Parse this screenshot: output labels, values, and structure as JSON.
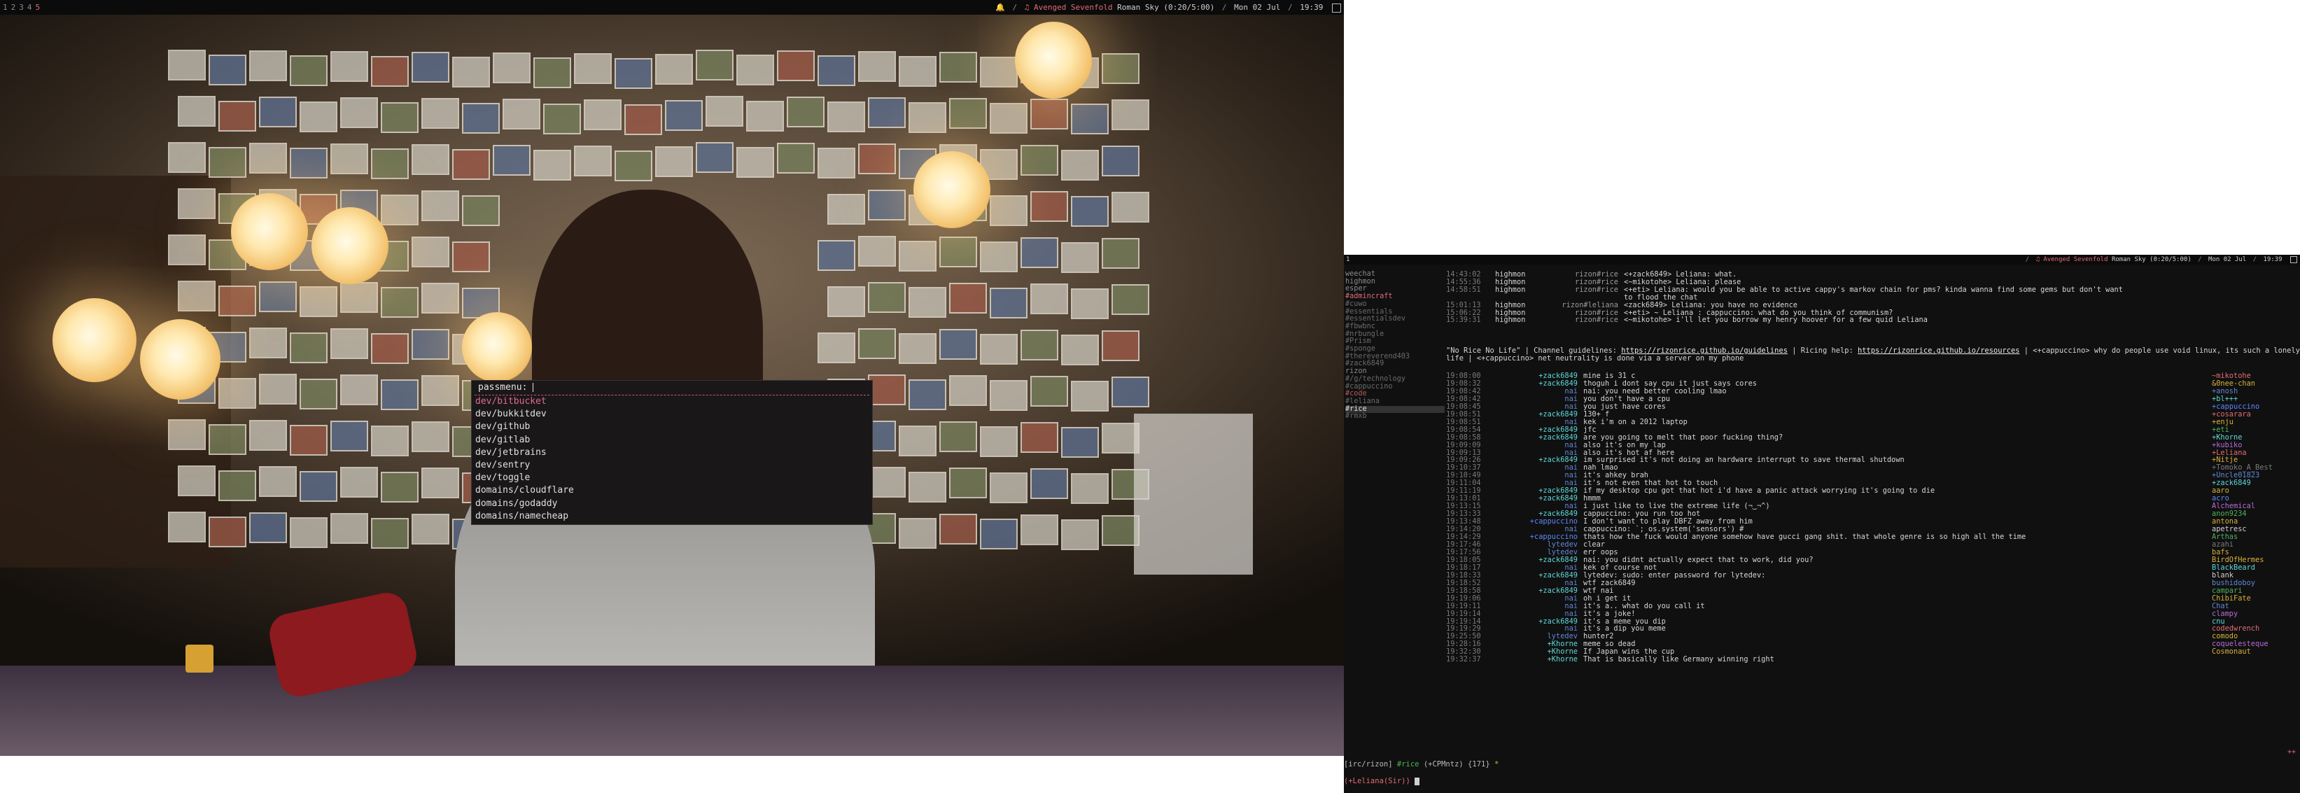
{
  "left_bar": {
    "workspaces": [
      "1",
      "2",
      "3",
      "4",
      "5"
    ],
    "active_workspace": "5",
    "bell": "🔔",
    "now_playing": "Avenged Sevenfold",
    "song": "Roman Sky",
    "track_time": "(0:20/5:00)",
    "date": "Mon 02 Jul",
    "time": "19:39"
  },
  "passmenu": {
    "prompt": "passmenu:",
    "items": [
      "dev/bitbucket",
      "dev/bukkitdev",
      "dev/github",
      "dev/gitlab",
      "dev/jetbrains",
      "dev/sentry",
      "dev/toggle",
      "domains/cloudflare",
      "domains/godaddy",
      "domains/namecheap"
    ],
    "selected_index": 0
  },
  "right_bar": {
    "workspace": "1",
    "now_playing": "Avenged Sevenfold",
    "song": "Roman Sky",
    "track_time": "(0:20/5:00)",
    "date": "Mon 02 Jul",
    "time": "19:39"
  },
  "buffers": [
    {
      "name": "weechat",
      "kind": "net"
    },
    {
      "name": "highmon",
      "kind": "net"
    },
    {
      "name": "esper",
      "kind": "net"
    },
    {
      "name": " #admincraft",
      "kind": "hot"
    },
    {
      "name": " #cuwo",
      "kind": "dim"
    },
    {
      "name": " #essentials",
      "kind": "dim"
    },
    {
      "name": " #essentialsdev",
      "kind": "dim"
    },
    {
      "name": " #fbwbnc",
      "kind": "dim"
    },
    {
      "name": " #nrbungle",
      "kind": "dim"
    },
    {
      "name": " #Prism",
      "kind": "dim"
    },
    {
      "name": " #sponge",
      "kind": "dim"
    },
    {
      "name": " #thereverend403",
      "kind": "dim"
    },
    {
      "name": " #zack6849",
      "kind": "dim"
    },
    {
      "name": "rizon",
      "kind": "net"
    },
    {
      "name": " #/g/technology",
      "kind": "dim"
    },
    {
      "name": " #cappuccino",
      "kind": "dim"
    },
    {
      "name": " #code",
      "kind": "red"
    },
    {
      "name": " #leliana",
      "kind": "dim"
    },
    {
      "name": " #rice",
      "kind": "cur"
    },
    {
      "name": " #rmxb",
      "kind": "dim"
    }
  ],
  "server_pane": [
    {
      "time": "14:43:02",
      "who": "highmon",
      "ch": "rizon#rice",
      "msg": "<+zack6849> Leliana: what."
    },
    {
      "time": "14:55:36",
      "who": "highmon",
      "ch": "rizon#rice",
      "msg": "<~mikotohe> Leliana: please"
    },
    {
      "time": "14:58:51",
      "who": "highmon",
      "ch": "rizon#rice",
      "msg": "<+eti> Leliana: would you be able to active cappy's markov chain for pms? kinda wanna find some gems but don't want"
    },
    {
      "time": "",
      "who": "",
      "ch": "",
      "msg": "to flood the chat"
    },
    {
      "time": "15:01:13",
      "who": "highmon",
      "ch": "rizon#leliana",
      "msg": "<zack6849> Leliana: you have no evidence"
    },
    {
      "time": "15:06:22",
      "who": "highmon",
      "ch": "rizon#rice",
      "msg": "<+eti> ~ Leliana : cappuccino: what do you think of communism?"
    },
    {
      "time": "15:39:31",
      "who": "highmon",
      "ch": "rizon#rice",
      "msg": "<~mikotohe> i'll let you borrow my henry hoover for a few quid Leliana"
    }
  ],
  "topic": {
    "pre": "\"No Rice No Life\" | Channel guidelines: ",
    "link1": "https://rizonrice.github.io/guidelines",
    "mid": " | Ricing help: ",
    "link2": "https://rizonrice.github.io/resources",
    "post": " | <+cappuccino> why do people use void linux, its such a lonely life | <+cappuccino> net neutrality is done via a server on my phone"
  },
  "chat": [
    {
      "time": "19:08:00",
      "nick": "+zack6849",
      "c": "#5fd7d7",
      "msg": "mine is 31 c"
    },
    {
      "time": "19:08:32",
      "nick": "+zack6849",
      "c": "#5fd7d7",
      "msg": "thoguh i dont say cpu it just says cores"
    },
    {
      "time": "19:08:42",
      "nick": "nai",
      "c": "#5f87d7",
      "msg": "nai: you need better cooling lmao"
    },
    {
      "time": "19:08:42",
      "nick": "nai",
      "c": "#5f87d7",
      "msg": "you don't have a cpu"
    },
    {
      "time": "19:08:45",
      "nick": "nai",
      "c": "#5f87d7",
      "msg": "you just have cores"
    },
    {
      "time": "19:08:51",
      "nick": "+zack6849",
      "c": "#5fd7d7",
      "msg": "130+ f"
    },
    {
      "time": "19:08:51",
      "nick": "nai",
      "c": "#5f87d7",
      "msg": "kek i'm on a 2012 laptop"
    },
    {
      "time": "19:08:54",
      "nick": "+zack6849",
      "c": "#5fd7d7",
      "msg": "jfc"
    },
    {
      "time": "19:08:58",
      "nick": "+zack6849",
      "c": "#5fd7d7",
      "msg": "are you going to melt that poor fucking thing?"
    },
    {
      "time": "19:09:09",
      "nick": "nai",
      "c": "#5f87d7",
      "msg": "also it's on my lap"
    },
    {
      "time": "19:09:13",
      "nick": "nai",
      "c": "#5f87d7",
      "msg": "also it's hot af here"
    },
    {
      "time": "19:09:26",
      "nick": "+zack6849",
      "c": "#5fd7d7",
      "msg": "im surprised it's not doing an hardware interrupt to save thermal shutdown"
    },
    {
      "time": "19:10:37",
      "nick": "nai",
      "c": "#5f87d7",
      "msg": "nah lmao"
    },
    {
      "time": "19:10:49",
      "nick": "nai",
      "c": "#5f87d7",
      "msg": "it's ahkey brah"
    },
    {
      "time": "19:11:04",
      "nick": "nai",
      "c": "#5f87d7",
      "msg": "it's not even that hot to touch"
    },
    {
      "time": "19:11:19",
      "nick": "+zack6849",
      "c": "#5fd7d7",
      "msg": "if my desktop cpu got that hot i'd have a panic attack worrying it's going to die"
    },
    {
      "time": "19:13:01",
      "nick": "+zack6849",
      "c": "#5fd7d7",
      "msg": "hmmm"
    },
    {
      "time": "19:13:15",
      "nick": "nai",
      "c": "#5f87d7",
      "msg": "i just like to live the extreme life (¬‿¬^)"
    },
    {
      "time": "19:13:33",
      "nick": "+zack6849",
      "c": "#5fd7d7",
      "msg": "cappuccino: you run too hot"
    },
    {
      "time": "19:13:48",
      "nick": "+cappuccino",
      "c": "#5f87ff",
      "msg": "I don't want to play DBFZ away from him"
    },
    {
      "time": "19:14:20",
      "nick": "nai",
      "c": "#5f87d7",
      "msg": "cappuccino: `; os.system('sensors') #"
    },
    {
      "time": "19:14:29",
      "nick": "+cappuccino",
      "c": "#5f87ff",
      "msg": "thats how the fuck would anyone somehow have gucci gang shit. that whole genre is so high all the time"
    },
    {
      "time": "19:17:46",
      "nick": "lytedev",
      "c": "#5f87d7",
      "msg": "clear"
    },
    {
      "time": "19:17:56",
      "nick": "lytedev",
      "c": "#5f87d7",
      "msg": "err oops"
    },
    {
      "time": "19:18:05",
      "nick": "+zack6849",
      "c": "#5fd7d7",
      "msg": "nai: you didnt actually expect that to work, did you?"
    },
    {
      "time": "19:18:17",
      "nick": "nai",
      "c": "#5f87d7",
      "msg": "kek of course not"
    },
    {
      "time": "19:18:33",
      "nick": "+zack6849",
      "c": "#5fd7d7",
      "msg": "lytedev: sudo: enter password for lytedev:"
    },
    {
      "time": "19:18:52",
      "nick": "nai",
      "c": "#5f87d7",
      "msg": "wtf zack6849"
    },
    {
      "time": "19:18:58",
      "nick": "+zack6849",
      "c": "#5fd7d7",
      "msg": "wtf nai"
    },
    {
      "time": "19:19:06",
      "nick": "nai",
      "c": "#5f87d7",
      "msg": "oh i get it"
    },
    {
      "time": "19:19:11",
      "nick": "nai",
      "c": "#5f87d7",
      "msg": "it's a.. what do you call it"
    },
    {
      "time": "19:19:14",
      "nick": "nai",
      "c": "#5f87d7",
      "msg": "it's a joke!"
    },
    {
      "time": "19:19:14",
      "nick": "+zack6849",
      "c": "#5fd7d7",
      "msg": "it's a meme you dip"
    },
    {
      "time": "19:19:29",
      "nick": "nai",
      "c": "#5f87d7",
      "msg": "it's a dip you meme"
    },
    {
      "time": "19:25:50",
      "nick": "lytedev",
      "c": "#5f87d7",
      "msg": "hunter2"
    },
    {
      "time": "19:28:16",
      "nick": "+Khorne",
      "c": "#5fd7d7",
      "msg": "meme so dead"
    },
    {
      "time": "19:32:30",
      "nick": "+Khorne",
      "c": "#5fd7d7",
      "msg": "If Japan wins the cup"
    },
    {
      "time": "19:32:37",
      "nick": "+Khorne",
      "c": "#5fd7d7",
      "msg": "That is basically like Germany winning right"
    }
  ],
  "nicklist": [
    {
      "n": "~mikotohe",
      "c": "#e06c75"
    },
    {
      "n": "&0nee-chan",
      "c": "#d6b13a"
    },
    {
      "n": "+anosh",
      "c": "#5f87d7"
    },
    {
      "n": "+bl+++",
      "c": "#5fd7d7"
    },
    {
      "n": "+cappuccino",
      "c": "#5f87ff"
    },
    {
      "n": "+cosarara",
      "c": "#e06c75"
    },
    {
      "n": "+enju",
      "c": "#d6b13a"
    },
    {
      "n": "+eti",
      "c": "#4fb35c"
    },
    {
      "n": "+Khorne",
      "c": "#5fd7d7"
    },
    {
      "n": "+kubiko",
      "c": "#b56cd6"
    },
    {
      "n": "+Leliana",
      "c": "#e06c75"
    },
    {
      "n": "+Nitje",
      "c": "#d6b13a"
    },
    {
      "n": "+Tomoko_A_Best",
      "c": "#7a7a7a"
    },
    {
      "n": "+Uncle01823",
      "c": "#5f87d7"
    },
    {
      "n": "+zack6849",
      "c": "#5fd7d7"
    },
    {
      "n": "aaro",
      "c": "#d6b13a"
    },
    {
      "n": "acro",
      "c": "#5f87ff"
    },
    {
      "n": "Alchemical",
      "c": "#b56cd6"
    },
    {
      "n": "anon9234",
      "c": "#4fb35c"
    },
    {
      "n": "antona",
      "c": "#d6b13a"
    },
    {
      "n": "apetresc",
      "c": "#cfcfcf"
    },
    {
      "n": "Arthas",
      "c": "#4fb35c"
    },
    {
      "n": "azahi",
      "c": "#7a7a7a"
    },
    {
      "n": "bafs",
      "c": "#d6b13a"
    },
    {
      "n": "BirdOfHermes",
      "c": "#d6b13a"
    },
    {
      "n": "BlackBeard",
      "c": "#5fd7d7"
    },
    {
      "n": "blank",
      "c": "#cfcfcf"
    },
    {
      "n": "bushidoboy",
      "c": "#5f87d7"
    },
    {
      "n": "campari",
      "c": "#4fb35c"
    },
    {
      "n": "ChibiFate",
      "c": "#d6b13a"
    },
    {
      "n": "Chat",
      "c": "#5f87d7"
    },
    {
      "n": "clampy",
      "c": "#b56cd6"
    },
    {
      "n": "cnu",
      "c": "#5fd7d7"
    },
    {
      "n": "codedwrench",
      "c": "#e06c75"
    },
    {
      "n": "comodo",
      "c": "#d6b13a"
    },
    {
      "n": "coquelesteque",
      "c": "#b56cd6"
    },
    {
      "n": "Cosmonaut",
      "c": "#d6b13a"
    }
  ],
  "statusline": {
    "buffer": "[irc/rizon]",
    "channel": "#rice",
    "mode": "(+CPMntz)",
    "count": "{171}",
    "act": "*"
  },
  "inputline": {
    "nick": "(+Leliana(Sir))"
  },
  "scroll_more": "++"
}
